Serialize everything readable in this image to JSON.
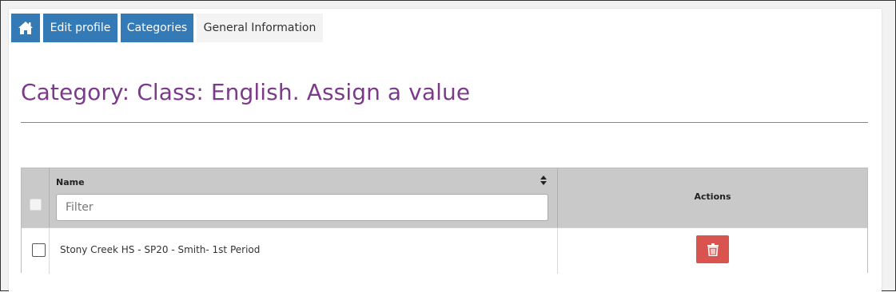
{
  "breadcrumb": {
    "home_icon": "home-icon",
    "items": [
      {
        "label": "Edit profile"
      },
      {
        "label": "Categories"
      },
      {
        "label": "General Information"
      }
    ]
  },
  "page": {
    "title": "Category: Class: English. Assign a value"
  },
  "table": {
    "columns": {
      "name": "Name",
      "actions": "Actions"
    },
    "filter_placeholder": "Filter",
    "filter_value": "",
    "rows": [
      {
        "name": "Stony Creek HS - SP20 - Smith- 1st Period",
        "action_icon": "trash-icon"
      }
    ]
  },
  "colors": {
    "brand_blue": "#337ab7",
    "title_purple": "#7b3a8a",
    "danger_red": "#d9534f",
    "header_gray": "#c9c9c9"
  }
}
